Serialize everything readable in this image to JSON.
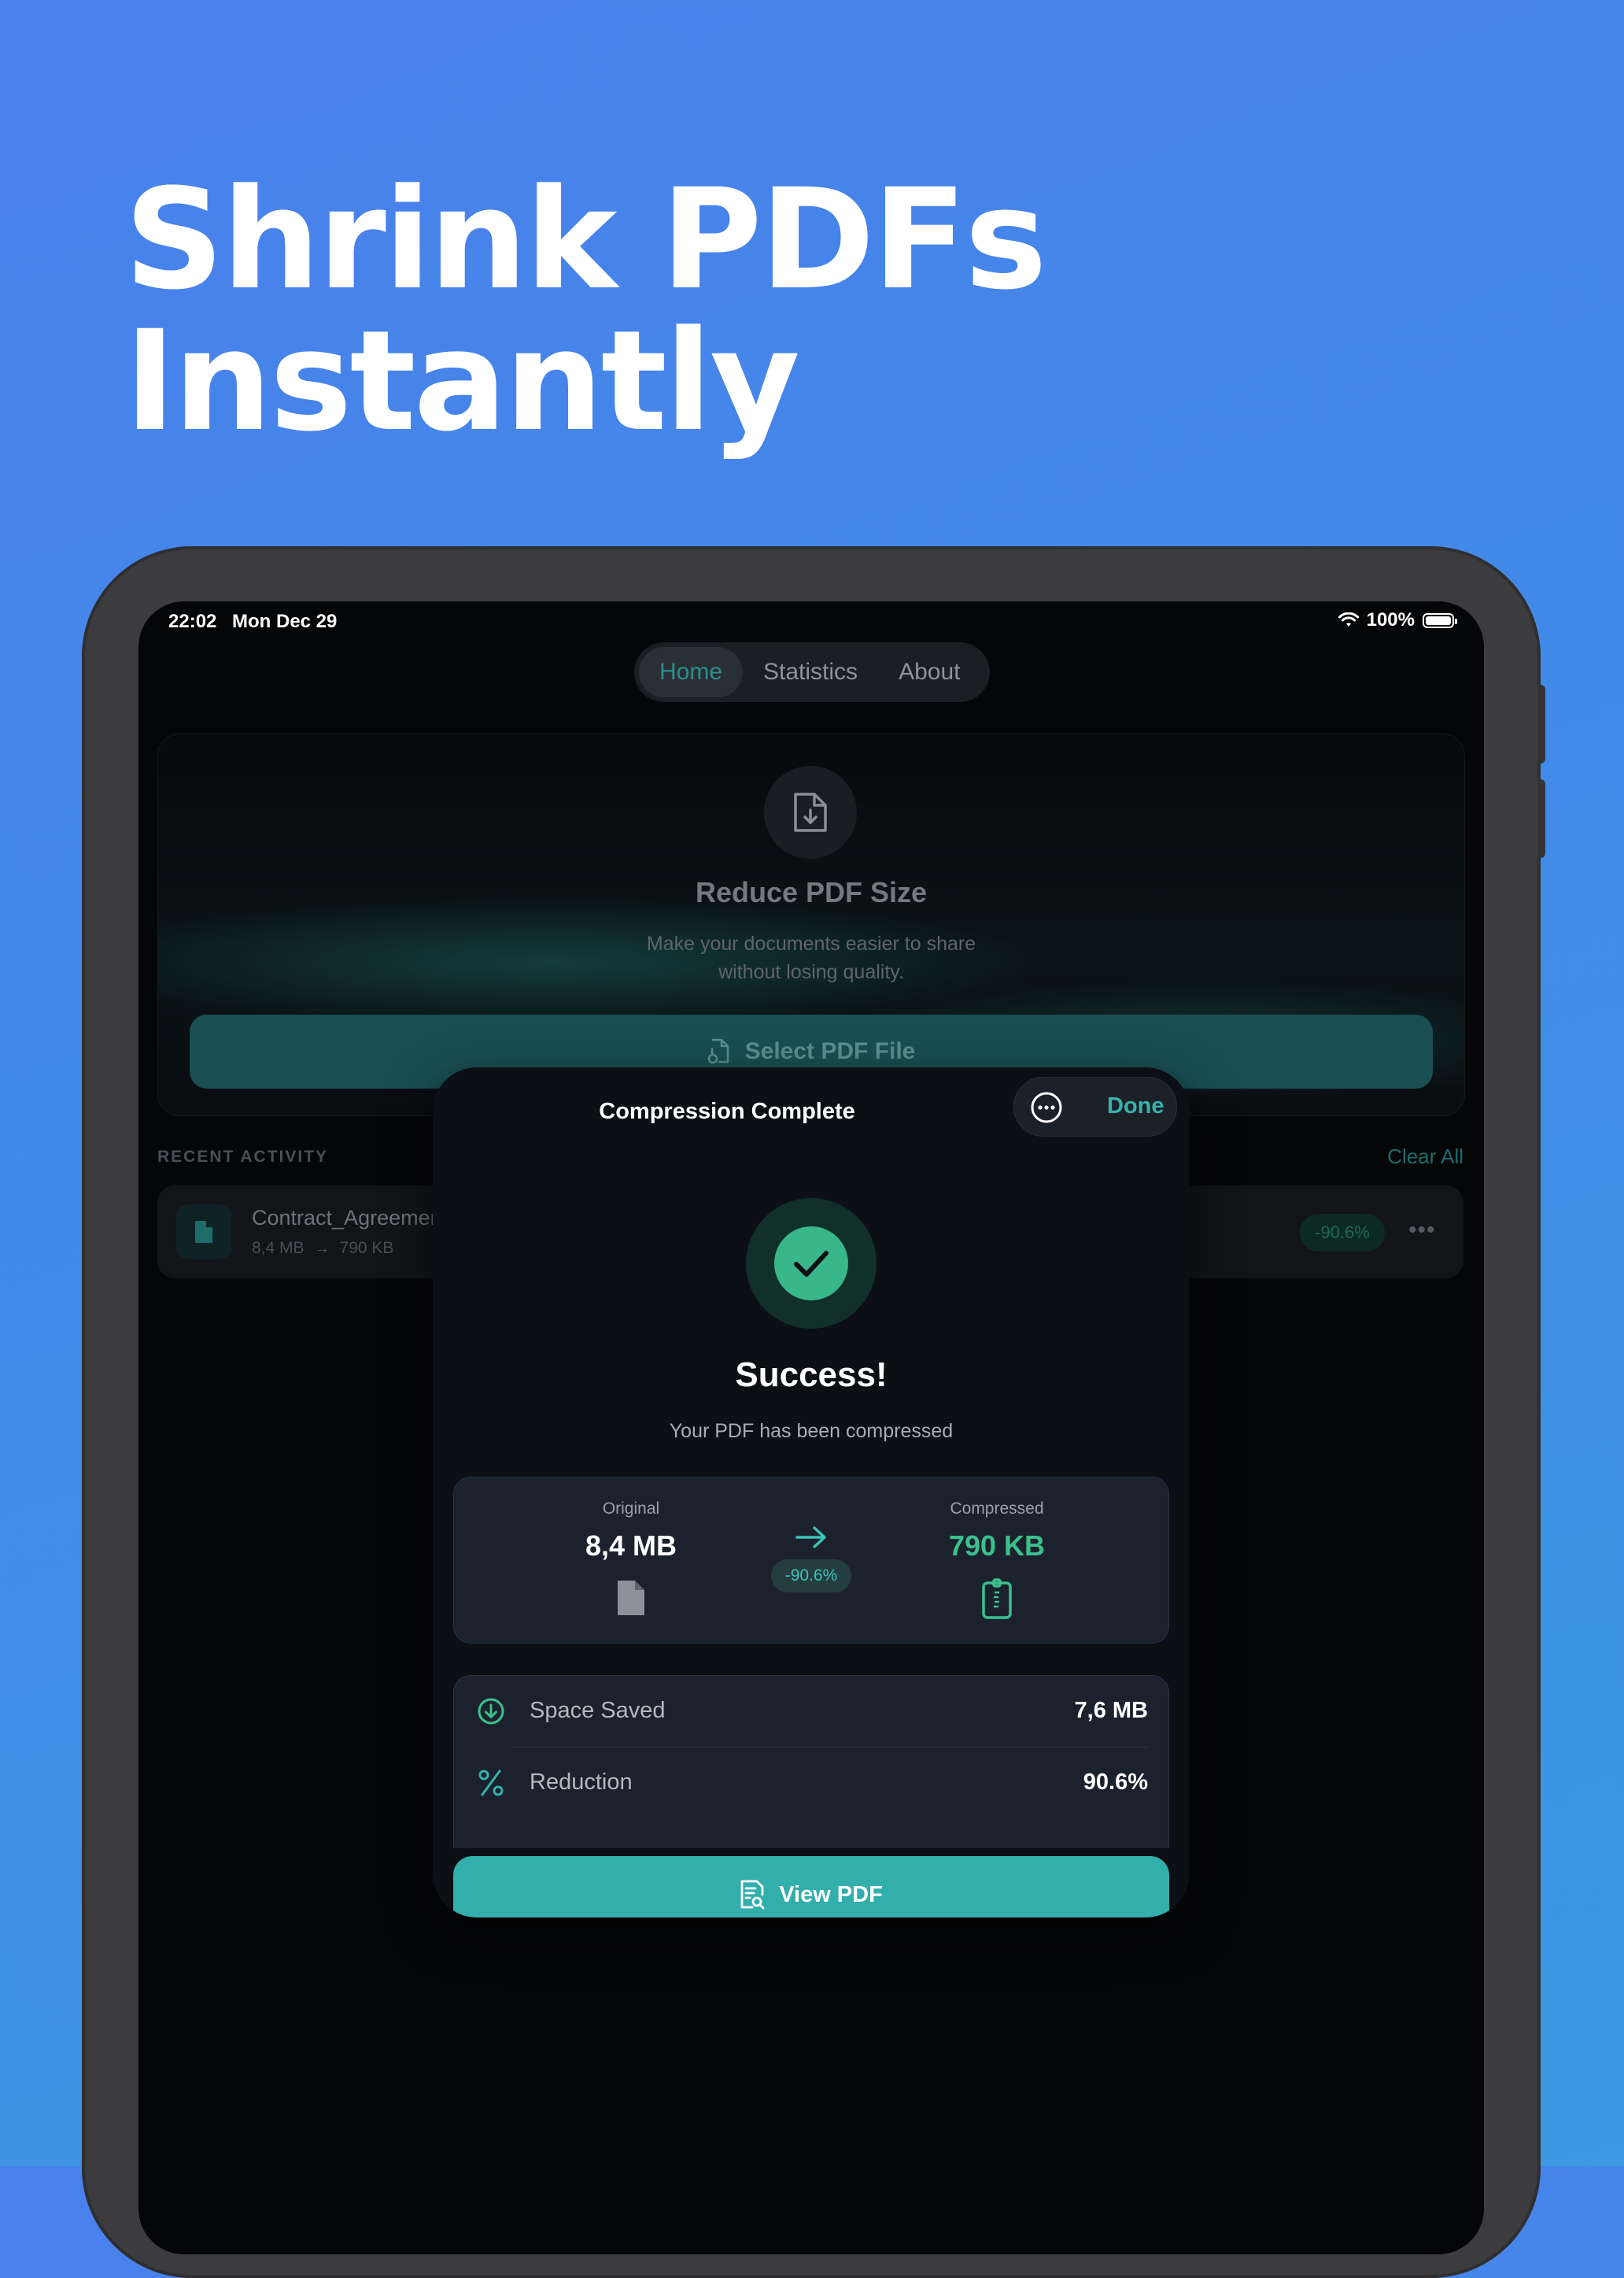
{
  "headline": {
    "line1": "Shrink PDFs",
    "line2": "Instantly"
  },
  "status_bar": {
    "time": "22:02",
    "date": "Mon Dec 29",
    "battery": "100%"
  },
  "nav": {
    "tabs": [
      {
        "label": "Home",
        "active": true
      },
      {
        "label": "Statistics",
        "active": false
      },
      {
        "label": "About",
        "active": false
      }
    ]
  },
  "hero": {
    "title": "Reduce PDF Size",
    "subtitle_line1": "Make your documents easier to share",
    "subtitle_line2": "without losing quality.",
    "button": "Select PDF File"
  },
  "recent": {
    "title": "RECENT ACTIVITY",
    "clear_all": "Clear All",
    "items": [
      {
        "name": "Contract_Agreemen",
        "original": "8,4 MB",
        "compressed": "790 KB",
        "reduction": "-90.6%"
      }
    ]
  },
  "sheet": {
    "title": "Compression Complete",
    "done": "Done",
    "success_title": "Success!",
    "success_sub": "Your PDF has been compressed",
    "original_label": "Original",
    "original_value": "8,4 MB",
    "compressed_label": "Compressed",
    "compressed_value": "790 KB",
    "reduction_badge": "-90.6%",
    "stats": [
      {
        "label": "Space Saved",
        "value": "7,6 MB",
        "icon": "arrow-down-circle-icon"
      },
      {
        "label": "Reduction",
        "value": "90.6%",
        "icon": "percent-icon"
      }
    ],
    "view_button": "View PDF"
  },
  "colors": {
    "accent": "#32aeac",
    "success": "#38b88a",
    "background_top": "#4a80ec",
    "background_bottom": "#3c99e2"
  }
}
